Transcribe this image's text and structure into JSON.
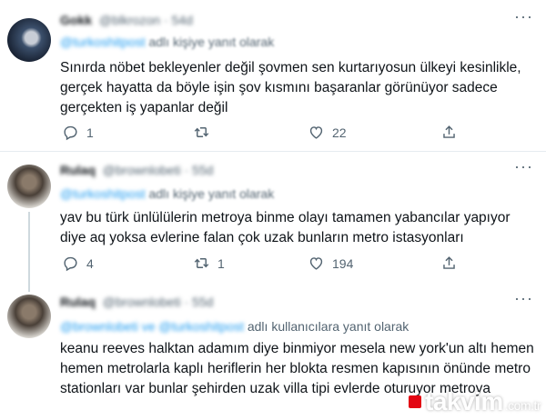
{
  "tweets": [
    {
      "display_name": "Gokk",
      "handle": "@blkrozon",
      "time": "54d",
      "reply_to": "@turkoshitpost",
      "reply_suffix": "adlı kişiye yanıt olarak",
      "lines": [
        "Sınırda nöbet bekleyenler değil şovmen sen kurtarıyosun ülkeyi kesinlikle,",
        "gerçek hayatta da böyle işin şov kısmını başaranlar görünüyor sadece",
        "gerçekten iş yapanlar değil"
      ],
      "replies": "1",
      "retweets": "",
      "likes": "22"
    },
    {
      "display_name": "Rulaq",
      "handle": "@brownlobeti",
      "time": "55d",
      "reply_to": "@turkoshitpost",
      "reply_suffix": "adlı kişiye yanıt olarak",
      "lines": [
        "yav bu türk ünlülülerin metroya binme olayı tamamen yabancılar yapıyor",
        "diye aq yoksa evlerine falan çok uzak bunların metro istasyonları"
      ],
      "replies": "4",
      "retweets": "1",
      "likes": "194"
    },
    {
      "display_name": "Rulaq",
      "handle": "@brownlobeti",
      "time": "55d",
      "reply_to": "@brownlobeti ve @turkoshitpost",
      "reply_suffix": "adlı kullanıcılara yanıt olarak",
      "lines": [
        "keanu reeves halktan adamım diye binmiyor mesela new york'un altı hemen",
        "hemen metrolarla kaplı heriflerin her blokta resmen kapısının önünde metro",
        "stationları var bunlar şehirden uzak villa tipi evlerde oturuyor metroya"
      ]
    }
  ],
  "watermark": {
    "brand": "takvim",
    "tld": ".com.tr"
  },
  "colors": {
    "accent": "#1d9bf0",
    "muted": "#536471",
    "text": "#0f1419",
    "watermark_red": "#e30613"
  },
  "icons": {
    "reply": "reply-icon",
    "retweet": "retweet-icon",
    "like": "heart-icon",
    "share": "share-icon",
    "more": "more-icon"
  }
}
